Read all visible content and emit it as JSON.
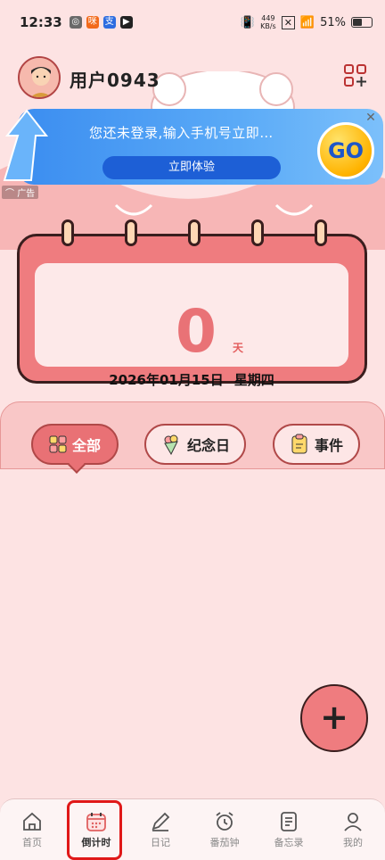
{
  "status_bar": {
    "time": "12:33",
    "net_speed_value": "449",
    "net_speed_unit": "KB/s",
    "battery": "51%"
  },
  "header": {
    "username": "用户0943"
  },
  "ad": {
    "title": "您还未登录,输入手机号立即…",
    "button_label": "立即体验",
    "go_label": "GO",
    "tag": "广告"
  },
  "countdown": {
    "days_value": "0",
    "days_unit": "天",
    "date": "2026年01月15日",
    "weekday": "星期四"
  },
  "categories": [
    {
      "label": "全部",
      "icon": "grid-icon",
      "active": true
    },
    {
      "label": "纪念日",
      "icon": "bouquet-icon",
      "active": false
    },
    {
      "label": "事件",
      "icon": "notepad-icon",
      "active": false
    }
  ],
  "fab": {
    "symbol": "+"
  },
  "bottom_nav": [
    {
      "label": "首页",
      "icon": "home-icon"
    },
    {
      "label": "倒计时",
      "icon": "calendar-icon"
    },
    {
      "label": "日记",
      "icon": "pencil-icon"
    },
    {
      "label": "番茄钟",
      "icon": "alarm-clock-icon"
    },
    {
      "label": "备忘录",
      "icon": "memo-icon"
    },
    {
      "label": "我的",
      "icon": "profile-icon"
    }
  ],
  "active_nav_index": 1,
  "colors": {
    "background": "#fde3e3",
    "accent": "#ef7c7f",
    "ad_blue": "#3b8df0",
    "highlight_red": "#e01818"
  }
}
